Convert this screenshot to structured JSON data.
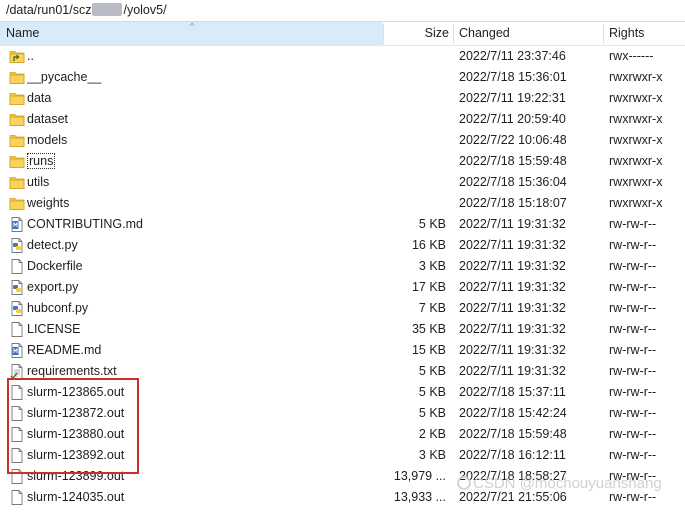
{
  "path": {
    "prefix": "/data/run01/scz",
    "suffix": "/yolov5/"
  },
  "columns": {
    "name": "Name",
    "size": "Size",
    "changed": "Changed",
    "rights": "Rights",
    "sort_glyph": "^"
  },
  "files": [
    {
      "name": "..",
      "type": "parent",
      "size": "",
      "changed": "2022/7/11 23:37:46",
      "rights": "rwx------"
    },
    {
      "name": "__pycache__",
      "type": "folder",
      "size": "",
      "changed": "2022/7/18 15:36:01",
      "rights": "rwxrwxr-x"
    },
    {
      "name": "data",
      "type": "folder",
      "size": "",
      "changed": "2022/7/11 19:22:31",
      "rights": "rwxrwxr-x"
    },
    {
      "name": "dataset",
      "type": "folder",
      "size": "",
      "changed": "2022/7/11 20:59:40",
      "rights": "rwxrwxr-x"
    },
    {
      "name": "models",
      "type": "folder",
      "size": "",
      "changed": "2022/7/22 10:06:48",
      "rights": "rwxrwxr-x"
    },
    {
      "name": "runs",
      "type": "folder",
      "size": "",
      "changed": "2022/7/18 15:59:48",
      "rights": "rwxrwxr-x",
      "selected": true
    },
    {
      "name": "utils",
      "type": "folder",
      "size": "",
      "changed": "2022/7/18 15:36:04",
      "rights": "rwxrwxr-x"
    },
    {
      "name": "weights",
      "type": "folder",
      "size": "",
      "changed": "2022/7/18 15:18:07",
      "rights": "rwxrwxr-x"
    },
    {
      "name": "CONTRIBUTING.md",
      "type": "md",
      "size": "5 KB",
      "changed": "2022/7/11 19:31:32",
      "rights": "rw-rw-r--"
    },
    {
      "name": "detect.py",
      "type": "py",
      "size": "16 KB",
      "changed": "2022/7/11 19:31:32",
      "rights": "rw-rw-r--"
    },
    {
      "name": "Dockerfile",
      "type": "file",
      "size": "3 KB",
      "changed": "2022/7/11 19:31:32",
      "rights": "rw-rw-r--"
    },
    {
      "name": "export.py",
      "type": "py",
      "size": "17 KB",
      "changed": "2022/7/11 19:31:32",
      "rights": "rw-rw-r--"
    },
    {
      "name": "hubconf.py",
      "type": "py",
      "size": "7 KB",
      "changed": "2022/7/11 19:31:32",
      "rights": "rw-rw-r--"
    },
    {
      "name": "LICENSE",
      "type": "file",
      "size": "35 KB",
      "changed": "2022/7/11 19:31:32",
      "rights": "rw-rw-r--"
    },
    {
      "name": "README.md",
      "type": "md",
      "size": "15 KB",
      "changed": "2022/7/11 19:31:32",
      "rights": "rw-rw-r--"
    },
    {
      "name": "requirements.txt",
      "type": "txt",
      "size": "5 KB",
      "changed": "2022/7/11 19:31:32",
      "rights": "rw-rw-r--"
    },
    {
      "name": "slurm-123865.out",
      "type": "file",
      "size": "5 KB",
      "changed": "2022/7/18 15:37:11",
      "rights": "rw-rw-r--"
    },
    {
      "name": "slurm-123872.out",
      "type": "file",
      "size": "5 KB",
      "changed": "2022/7/18 15:42:24",
      "rights": "rw-rw-r--"
    },
    {
      "name": "slurm-123880.out",
      "type": "file",
      "size": "2 KB",
      "changed": "2022/7/18 15:59:48",
      "rights": "rw-rw-r--"
    },
    {
      "name": "slurm-123892.out",
      "type": "file",
      "size": "3 KB",
      "changed": "2022/7/18 16:12:11",
      "rights": "rw-rw-r--"
    },
    {
      "name": "slurm-123899.out",
      "type": "file",
      "size": "13,979 ...",
      "changed": "2022/7/18 18:58:27",
      "rights": "rw-rw-r--"
    },
    {
      "name": "slurm-124035.out",
      "type": "file",
      "size": "13,933 ...",
      "changed": "2022/7/21 21:55:06",
      "rights": "rw-rw-r--"
    }
  ],
  "watermark": "CSDN @mochouyuanshang",
  "colors": {
    "header_sort": "#d9ebf9",
    "folder": "#f5c542",
    "md_icon": "#3b6fc5",
    "py_blue": "#3f7cc4",
    "py_yellow": "#f4cf43",
    "highlight_box": "#c9302c"
  }
}
